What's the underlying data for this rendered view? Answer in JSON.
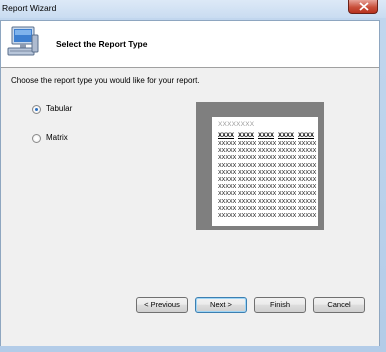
{
  "window": {
    "title": "Report Wizard"
  },
  "header": {
    "title": "Select the Report Type",
    "icon": "computer-wizard-icon"
  },
  "prompt": "Choose the report type you would like for your report.",
  "report_types": [
    {
      "label": "Tabular",
      "selected": true
    },
    {
      "label": "Matrix",
      "selected": false
    }
  ],
  "preview": {
    "title": "XXXXXXXX",
    "header_cells": [
      "XXXX",
      "XXXX",
      "XXXX",
      "XXXX",
      "XXXX"
    ],
    "row_cells": [
      "XXXXX",
      "XXXXX",
      "XXXXX",
      "XXXXX",
      "XXXXX"
    ],
    "row_count": 11
  },
  "buttons": {
    "previous": "< Previous",
    "next": "Next >",
    "finish": "Finish",
    "cancel": "Cancel"
  },
  "colors": {
    "close": "#c9503c",
    "accent": "#3c7fb1"
  }
}
